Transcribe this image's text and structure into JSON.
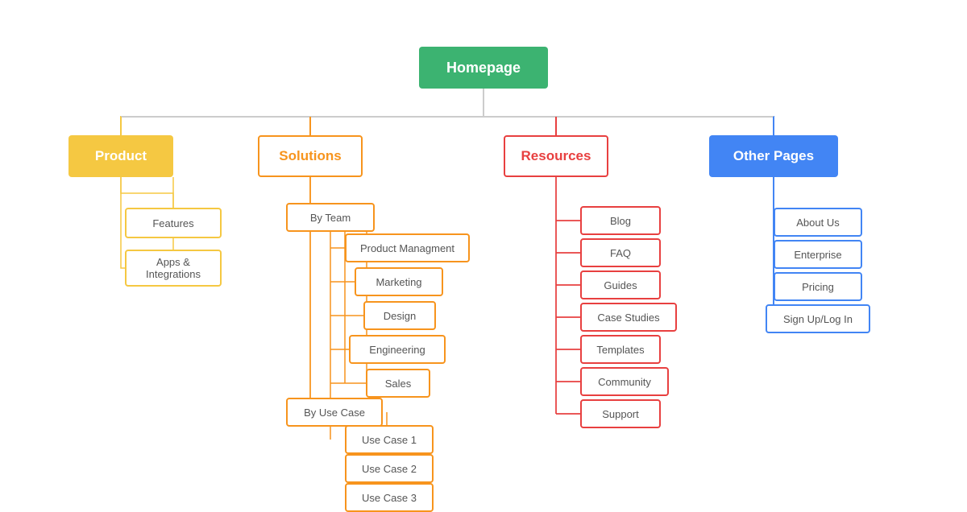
{
  "nodes": {
    "homepage": "Homepage",
    "product": "Product",
    "solutions": "Solutions",
    "resources": "Resources",
    "other_pages": "Other Pages",
    "features": "Features",
    "apps_integrations": "Apps & Integrations",
    "by_team": "By Team",
    "product_management": "Product Managment",
    "marketing": "Marketing",
    "design": "Design",
    "engineering": "Engineering",
    "sales": "Sales",
    "by_use_case": "By Use Case",
    "use_case_1": "Use Case 1",
    "use_case_2": "Use Case 2",
    "use_case_3": "Use Case 3",
    "blog": "Blog",
    "faq": "FAQ",
    "guides": "Guides",
    "case_studies": "Case Studies",
    "templates": "Templates",
    "community": "Community",
    "support": "Support",
    "about_us": "About Us",
    "enterprise": "Enterprise",
    "pricing": "Pricing",
    "sign_up_log_in": "Sign Up/Log In"
  },
  "colors": {
    "homepage_bg": "#3cb371",
    "product_bg": "#f5c842",
    "solutions_border": "#f7941d",
    "resources_border": "#e84040",
    "other_pages_bg": "#4285f4",
    "connector_product": "#f5c842",
    "connector_solutions": "#f7941d",
    "connector_resources": "#e84040",
    "connector_other": "#4285f4",
    "connector_center": "#4285f4"
  }
}
